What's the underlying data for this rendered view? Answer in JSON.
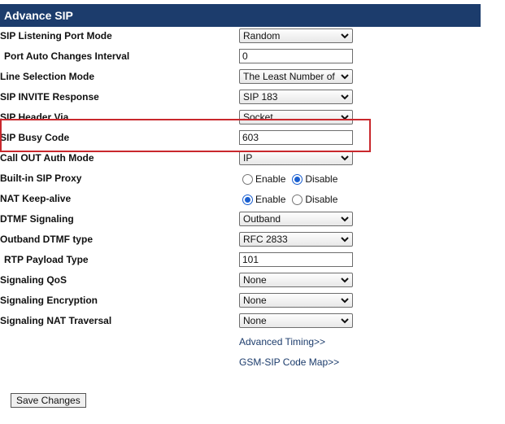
{
  "header": {
    "title": "Advance SIP"
  },
  "rows": {
    "listening_port_mode": {
      "label": "SIP Listening Port Mode",
      "value": "Random"
    },
    "port_auto_changes_interval": {
      "label": "Port Auto Changes Interval",
      "value": "0"
    },
    "line_selection_mode": {
      "label": "Line Selection Mode",
      "value": "The Least Number of Calls"
    },
    "sip_invite_response": {
      "label": "SIP INVITE Response",
      "value": "SIP 183"
    },
    "sip_header_via": {
      "label": "SIP Header Via",
      "value": "Socket"
    },
    "sip_busy_code": {
      "label": "SIP Busy Code",
      "value": "603"
    },
    "call_out_auth_mode": {
      "label": "Call OUT Auth Mode",
      "value": "IP"
    },
    "builtin_sip_proxy": {
      "label": "Built-in SIP Proxy",
      "option1": "Enable",
      "option2": "Disable",
      "selected": "Disable"
    },
    "nat_keep_alive": {
      "label": "NAT Keep-alive",
      "option1": "Enable",
      "option2": "Disable",
      "selected": "Enable"
    },
    "dtmf_signaling": {
      "label": "DTMF Signaling",
      "value": "Outband"
    },
    "outband_dtmf_type": {
      "label": "Outband DTMF type",
      "value": "RFC 2833"
    },
    "rtp_payload_type": {
      "label": "RTP Payload Type",
      "value": "101"
    },
    "signaling_qos": {
      "label": "Signaling QoS",
      "value": "None"
    },
    "signaling_encryption": {
      "label": "Signaling Encryption",
      "value": "None"
    },
    "signaling_nat_traversal": {
      "label": "Signaling NAT Traversal",
      "value": "None"
    }
  },
  "links": {
    "advanced_timing": "Advanced Timing>>",
    "gsm_sip_code_map": "GSM-SIP Code Map>>"
  },
  "actions": {
    "save_label": "Save Changes"
  },
  "colors": {
    "header_bg": "#1c3c6c",
    "highlight_border": "#c9282d",
    "radio_selected": "#1a5fd0"
  }
}
